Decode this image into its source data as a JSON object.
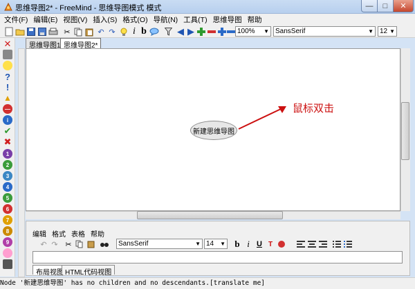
{
  "window": {
    "title": "思维导图2* - FreeMind - 思维导图模式 模式",
    "min_label": "—",
    "max_label": "□",
    "close_label": "✕"
  },
  "menubar": [
    "文件(F)",
    "编辑(E)",
    "视图(V)",
    "插入(S)",
    "格式(O)",
    "导航(N)",
    "工具(T)",
    "思维导图",
    "帮助"
  ],
  "toolbar": {
    "zoom": "100%",
    "font": "SansSerif",
    "size": "12",
    "italic_label": "i",
    "bold_label": "b"
  },
  "tabs": [
    "思维导图1*",
    "思维导图2*"
  ],
  "map": {
    "root_node": "新建思维导图",
    "annotation": "鼠标双击",
    "annotation_color": "#cc1010"
  },
  "editor": {
    "menu": [
      "编辑",
      "格式",
      "表格",
      "帮助"
    ],
    "font": "SansSerif",
    "size": "14",
    "tabs": [
      "布局视图",
      "HTML代码视图"
    ]
  },
  "status": "Node '新建思维导图' has no children and no descendants.[translate me]"
}
